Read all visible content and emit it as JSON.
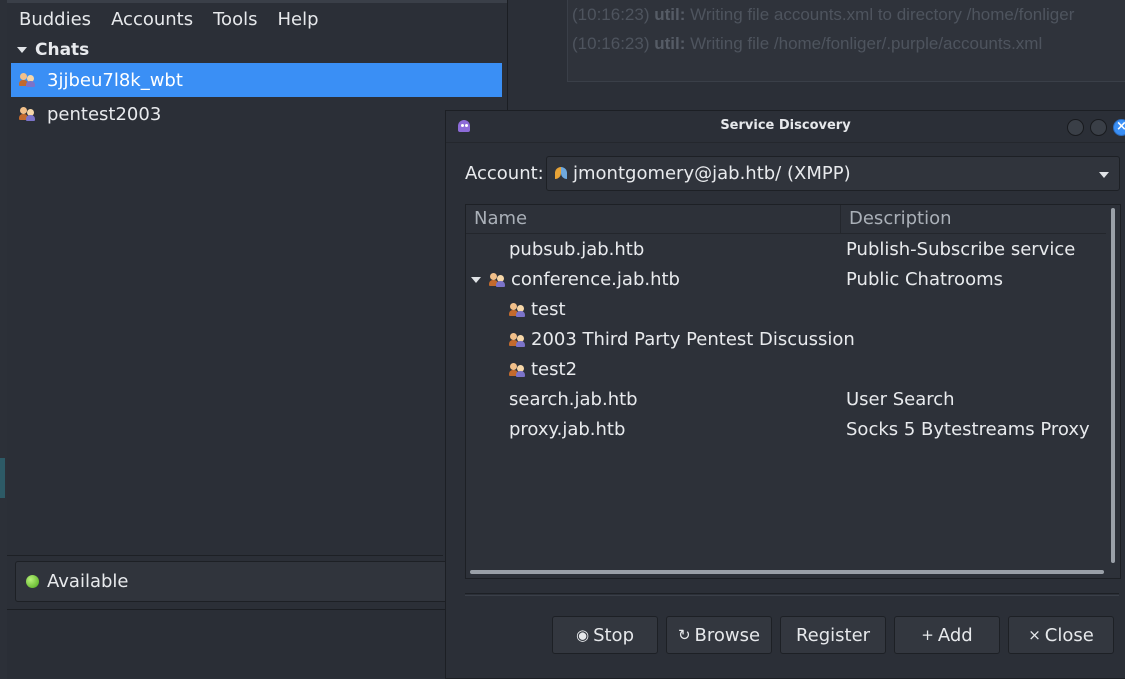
{
  "debug_log": {
    "lines": [
      {
        "time": "(10:16:23)",
        "module": "util:",
        "text": "Writing file accounts.xml to directory /home/fonliger"
      },
      {
        "time": "(10:16:23)",
        "module": "util:",
        "text": "Writing file /home/fonliger/.purple/accounts.xml"
      }
    ]
  },
  "buddy_list": {
    "menu": [
      "Buddies",
      "Accounts",
      "Tools",
      "Help"
    ],
    "group": "Chats",
    "chats": [
      "3jjbeu7l8k_wbt",
      "pentest2003"
    ],
    "selected_index": 0,
    "status": "Available"
  },
  "dialog": {
    "title": "Service Discovery",
    "account_label": "Account:",
    "account_value": "jmontgomery@jab.htb/ (XMPP)",
    "columns": [
      "Name",
      "Description"
    ],
    "rows": [
      {
        "name": "pubsub.jab.htb",
        "desc": "Publish-Subscribe service",
        "level": 0,
        "icon": "",
        "expander": false
      },
      {
        "name": "conference.jab.htb",
        "desc": "Public Chatrooms",
        "level": 0,
        "icon": "chat-icon",
        "expander": true
      },
      {
        "name": "test",
        "desc": "",
        "level": 1,
        "icon": "chat-icon",
        "expander": false
      },
      {
        "name": "2003 Third Party Pentest Discussion",
        "desc": "",
        "level": 1,
        "icon": "chat-icon",
        "expander": false
      },
      {
        "name": "test2",
        "desc": "",
        "level": 1,
        "icon": "chat-icon",
        "expander": false
      },
      {
        "name": "search.jab.htb",
        "desc": "User Search",
        "level": 0,
        "icon": "",
        "expander": false
      },
      {
        "name": "proxy.jab.htb",
        "desc": "Socks 5 Bytestreams Proxy",
        "level": 0,
        "icon": "",
        "expander": false
      }
    ],
    "buttons": {
      "stop": "Stop",
      "browse": "Browse",
      "register": "Register",
      "add": "Add",
      "close": "Close"
    },
    "button_icons": {
      "stop": "◉",
      "browse": "↻",
      "add": "+",
      "close": "×"
    }
  },
  "colors": {
    "selection": "#3a8ff5",
    "background": "#2b2f37",
    "status_online": "#4da71a"
  }
}
